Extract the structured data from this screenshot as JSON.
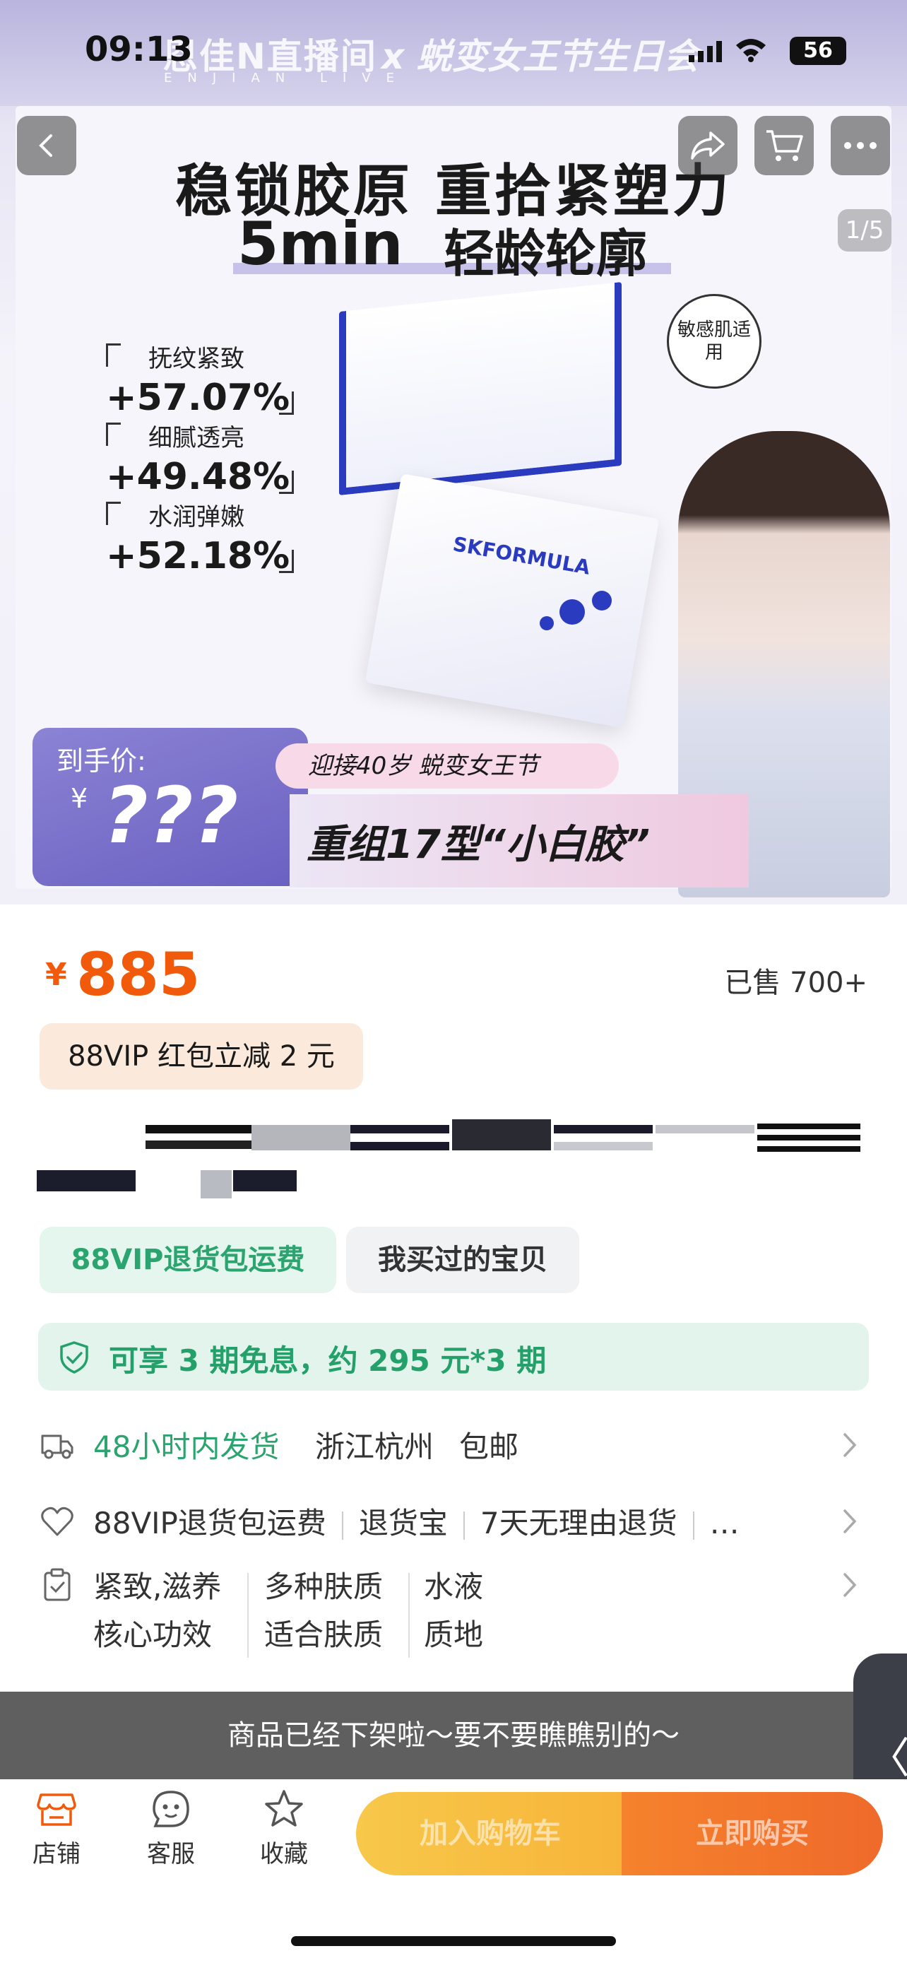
{
  "status_bar": {
    "time": "09:13",
    "battery": "56"
  },
  "hero": {
    "live_brand": "恩佳N直播间",
    "live_brand_sub": "ENJIAN LIVE",
    "live_event": "x 蜕变女王节生日会",
    "headline": "稳锁胶原 重拾紧塑力",
    "sub_num": "5min",
    "sub_text": "轻龄轮廓",
    "stats": [
      {
        "label": "抚纹紧致",
        "value": "+57.07%"
      },
      {
        "label": "细腻透亮",
        "value": "+49.48%"
      },
      {
        "label": "水润弹嫩",
        "value": "+52.18%"
      }
    ],
    "sensitive_badge": "敏感肌适用",
    "box_brand": "SKFORMULA",
    "price_card_label": "到手价:",
    "price_card_yen": "¥",
    "price_card_value": "???",
    "slogan_pill": "迎接40岁   蜕变女王节",
    "slogan_main": "重组17型“小白胶”",
    "image_counter": "1/5"
  },
  "product": {
    "price_symbol": "¥",
    "price": "885",
    "sold": "已售 700+",
    "vip_coupon": "88VIP 红包立减 2 元",
    "tags": [
      "88VIP退货包运费",
      "我买过的宝贝"
    ],
    "installment": "可享 3 期免息，约 295 元*3 期"
  },
  "shipping": {
    "time": "48小时内发货",
    "origin": "浙江杭州",
    "fee": "包邮"
  },
  "guarantees": [
    "88VIP退货包运费",
    "退货宝",
    "7天无理由退货",
    "…"
  ],
  "attributes": [
    {
      "value": "紧致,滋养",
      "key": "核心功效"
    },
    {
      "value": "多种肤质",
      "key": "适合肤质"
    },
    {
      "value": "水液",
      "key": "质地"
    }
  ],
  "delisted_notice": "商品已经下架啦～要不要瞧瞧别的～",
  "side_tab": "〈",
  "bottom_bar": {
    "store": "店铺",
    "service": "客服",
    "favorite": "收藏",
    "add_to_cart": "加入购物车",
    "buy_now": "立即购买"
  },
  "colors": {
    "price": "#f05a0a",
    "green": "#2ba46f",
    "accent_purple": "#6a60c2"
  }
}
